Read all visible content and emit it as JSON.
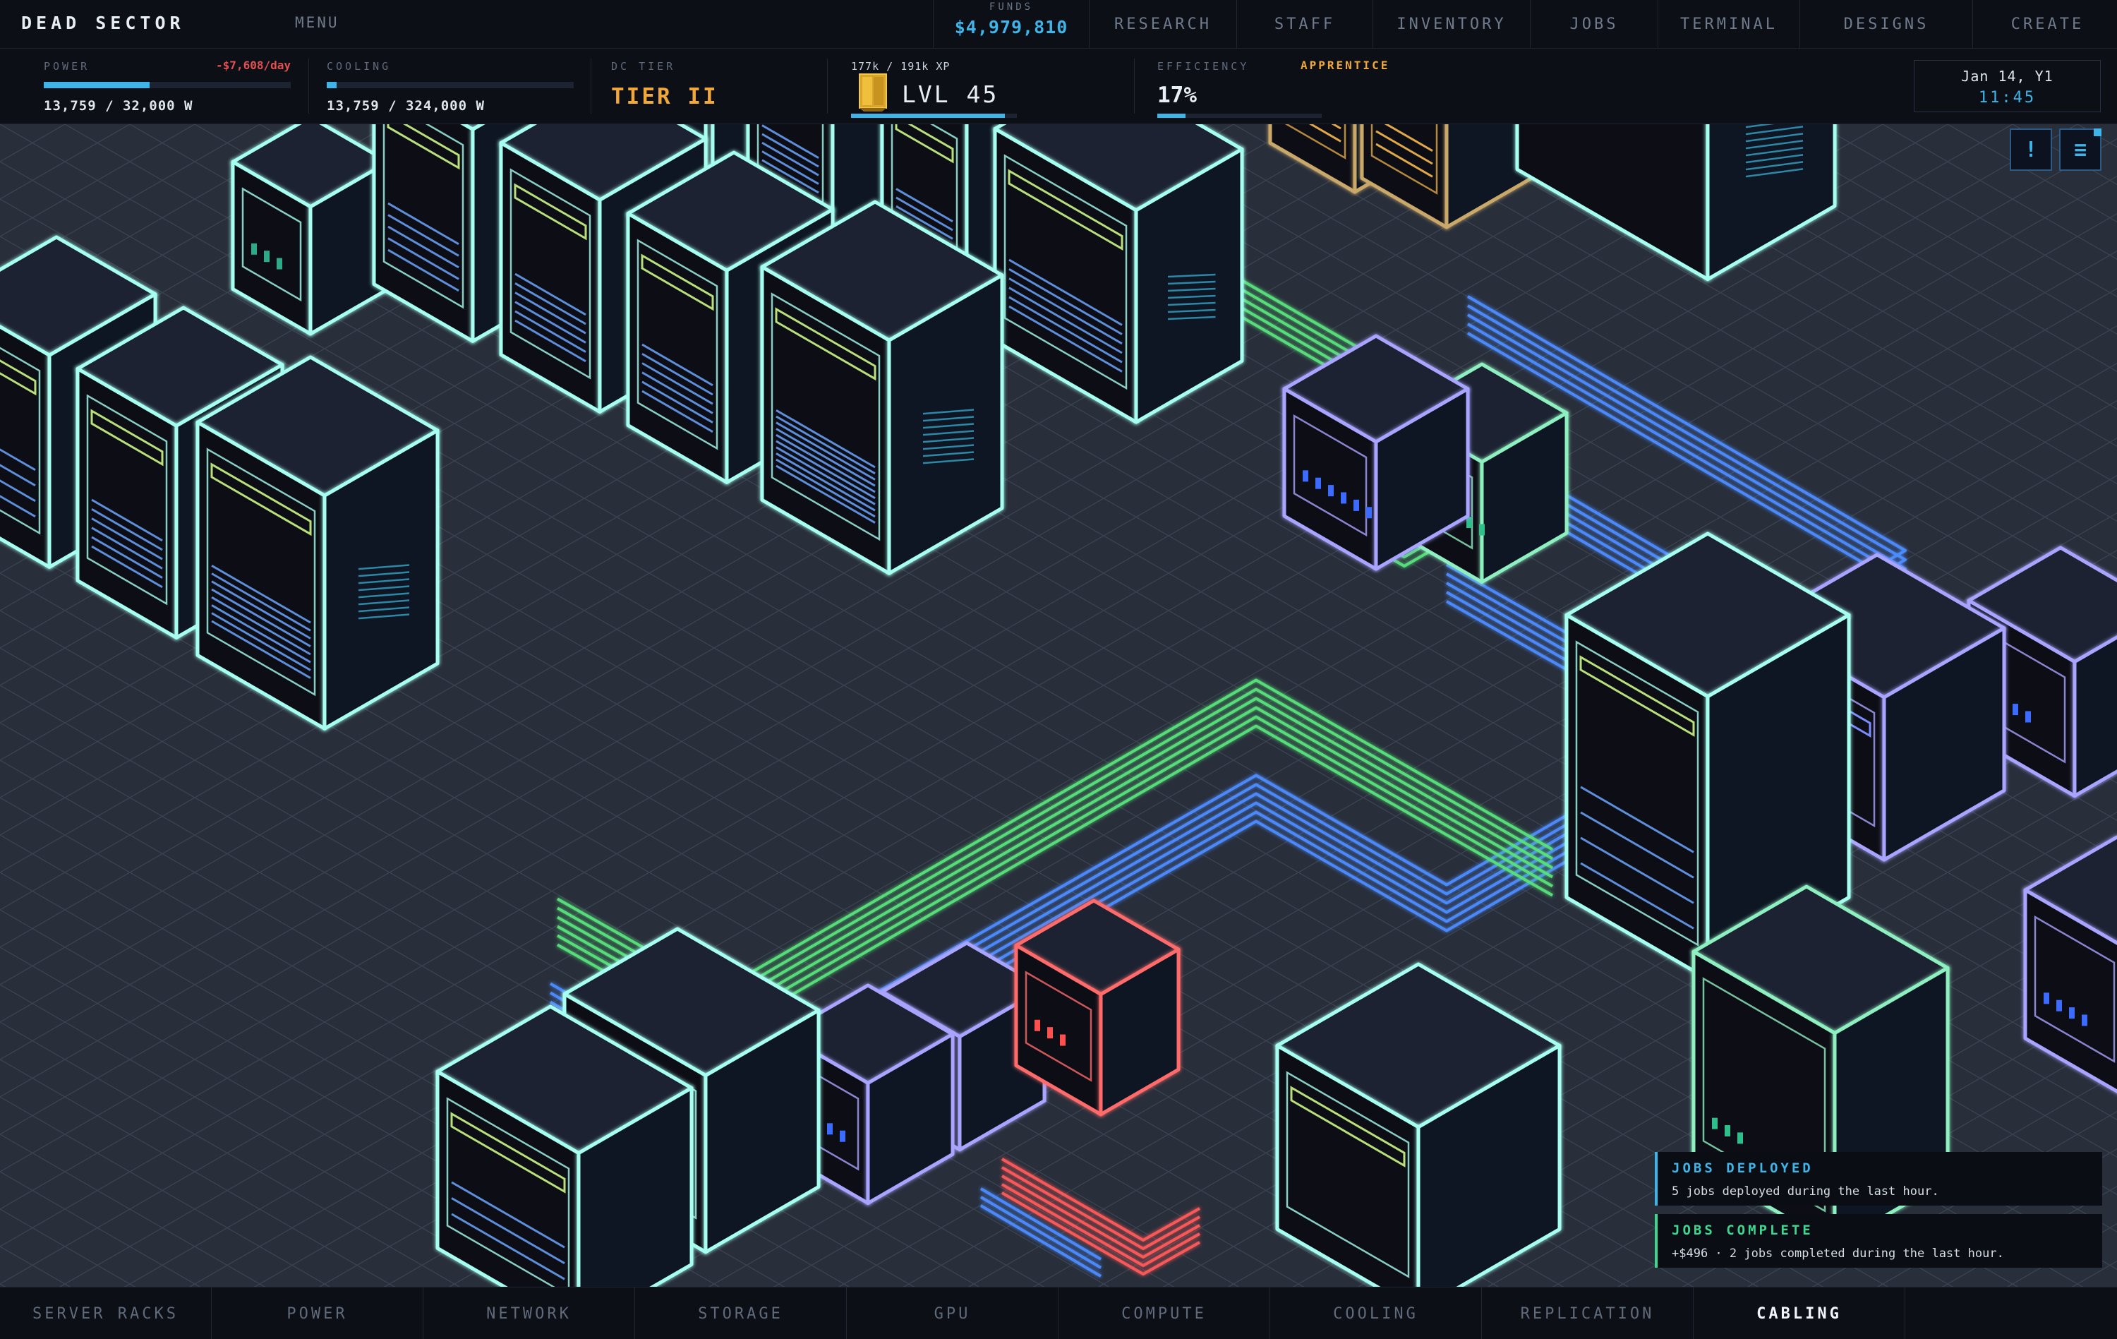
{
  "app": {
    "title": "DEAD SECTOR"
  },
  "topbar": {
    "menu_label": "MENU",
    "funds_label": "FUNDS",
    "funds_value": "$4,979,810",
    "tabs": [
      {
        "label": "RESEARCH"
      },
      {
        "label": "STAFF"
      },
      {
        "label": "INVENTORY"
      },
      {
        "label": "JOBS"
      },
      {
        "label": "TERMINAL"
      },
      {
        "label": "DESIGNS"
      },
      {
        "label": "CREATE"
      }
    ]
  },
  "stats": {
    "power": {
      "label": "POWER",
      "cost": "-$7,608/day",
      "value": "13,759 / 32,000 W",
      "fill": 0.43
    },
    "cooling": {
      "label": "COOLING",
      "value": "13,759 / 324,000 W",
      "fill": 0.04
    },
    "tier": {
      "label": "DC TIER",
      "value": "TIER II"
    },
    "xp": {
      "label": "177k / 191k XP",
      "level": "LVL 45",
      "fill": 0.93
    },
    "efficiency": {
      "label": "EFFICIENCY",
      "value": "17%",
      "rank": "APPRENTICE",
      "fill": 0.17
    }
  },
  "clock": {
    "date": "Jan 14, Y1",
    "time": "11:45"
  },
  "corner_buttons": {
    "alert_icon": "exclamation-icon",
    "alert_glyph": "!",
    "menu_icon": "hamburger-icon",
    "menu_glyph": "≡"
  },
  "notifications": [
    {
      "title": "JOBS DEPLOYED",
      "body": "5 jobs deployed during the last hour.",
      "color": "#3fb4e8"
    },
    {
      "title": "JOBS COMPLETE",
      "body": "+$496  ·  2 jobs completed during the last hour.",
      "color": "#3fd68f"
    }
  ],
  "bottom_tabs": [
    {
      "label": "SERVER RACKS"
    },
    {
      "label": "POWER"
    },
    {
      "label": "NETWORK"
    },
    {
      "label": "STORAGE"
    },
    {
      "label": "GPU"
    },
    {
      "label": "COMPUTE"
    },
    {
      "label": "COOLING"
    },
    {
      "label": "REPLICATION"
    },
    {
      "label": "CABLING",
      "active": true
    }
  ],
  "colors": {
    "accent": "#3fb4e8",
    "warning": "#e05050",
    "tier": "#f0a83a",
    "rack_outline": "#a6fff0",
    "compute_outline": "#a9a4ff",
    "alert_outline": "#ff6a6a",
    "cable_blue": "#4d8cff",
    "cable_green": "#57e07a"
  }
}
